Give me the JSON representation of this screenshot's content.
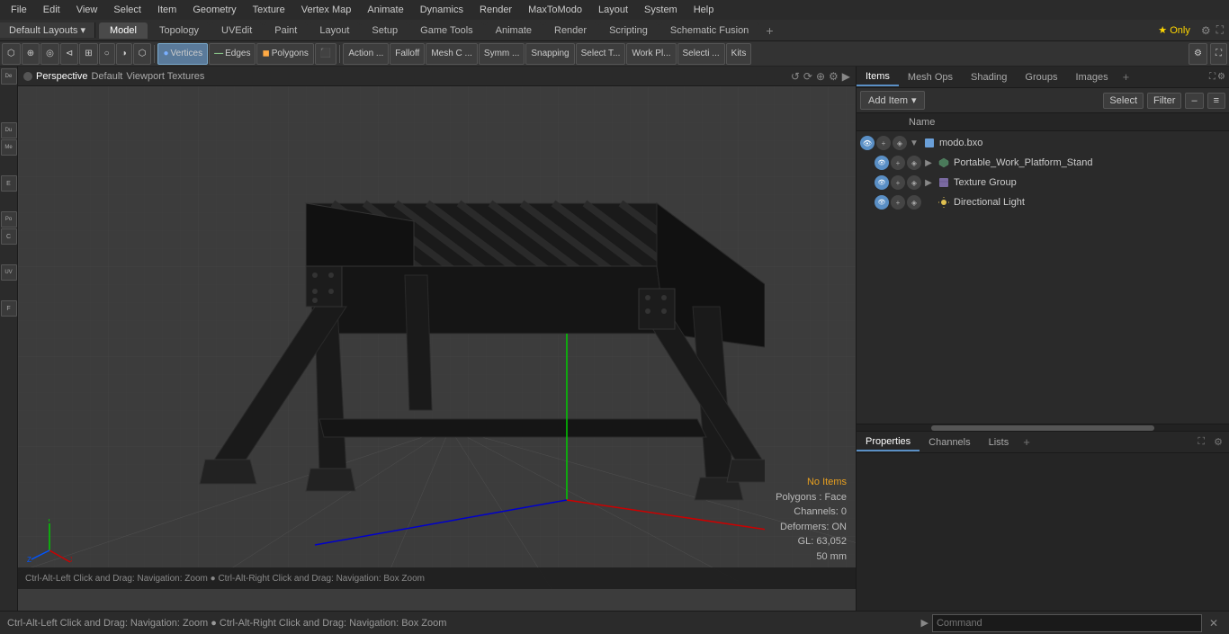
{
  "menu": {
    "items": [
      "File",
      "Edit",
      "View",
      "Select",
      "Item",
      "Geometry",
      "Texture",
      "Vertex Map",
      "Animate",
      "Dynamics",
      "Render",
      "MaxToModo",
      "Layout",
      "System",
      "Help"
    ]
  },
  "layouts_bar": {
    "default_layouts": "Default Layouts ▾",
    "tabs": [
      "Model",
      "Topology",
      "UVEdit",
      "Paint",
      "Layout",
      "Setup",
      "Game Tools",
      "Animate",
      "Render",
      "Scripting",
      "Schematic Fusion"
    ],
    "active_tab": "Model",
    "add_icon": "+",
    "star_only": "★ Only"
  },
  "toolbar": {
    "mode_buttons": [
      "▣",
      "⊕",
      "◎",
      "⊲",
      "⊞",
      "○",
      "◑",
      "⬡"
    ],
    "mesh_modes": [
      "Vertices",
      "Edges",
      "Polygons",
      "▣"
    ],
    "tools": [
      "Action ...",
      "Falloff",
      "Mesh C ...",
      "Symm ...",
      "Snapping",
      "Select T...",
      "Work Pl...",
      "Selecti ...",
      "Kits"
    ]
  },
  "viewport": {
    "dot": "●",
    "perspective": "Perspective",
    "default_label": "Default",
    "textures_label": "Viewport Textures",
    "controls": [
      "↺",
      "⟳",
      "⊕",
      "⚙",
      "▶"
    ]
  },
  "scene_info": {
    "no_items": "No Items",
    "polygons": "Polygons : Face",
    "channels": "Channels: 0",
    "deformers": "Deformers: ON",
    "gl": "GL: 63,052",
    "size": "50 mm"
  },
  "items_panel": {
    "tabs": [
      "Items",
      "Mesh Ops",
      "Shading",
      "Groups",
      "Images"
    ],
    "active_tab": "Items",
    "add_item_btn": "Add Item",
    "add_item_arrow": "▾",
    "select_btn": "Select",
    "filter_btn": "Filter",
    "minus_btn": "–",
    "settings_btn": "≡",
    "name_col": "Name",
    "tree": [
      {
        "id": "modo-bxo",
        "label": "modo.bxo",
        "icon": "cube",
        "level": 0,
        "expand": true,
        "eye": true
      },
      {
        "id": "portable-stand",
        "label": "Portable_Work_Platform_Stand",
        "icon": "mesh",
        "level": 1,
        "expand": false,
        "eye": true
      },
      {
        "id": "texture-group",
        "label": "Texture Group",
        "icon": "texture",
        "level": 1,
        "expand": false,
        "eye": true
      },
      {
        "id": "directional-light",
        "label": "Directional Light",
        "icon": "light",
        "level": 1,
        "expand": false,
        "eye": true
      }
    ]
  },
  "properties_panel": {
    "tabs": [
      "Properties",
      "Channels",
      "Lists"
    ],
    "active_tab": "Properties",
    "add_icon": "+"
  },
  "bottom_bar": {
    "status_text": "Ctrl-Alt-Left Click and Drag: Navigation: Zoom ● Ctrl-Alt-Right Click and Drag: Navigation: Box Zoom",
    "arrow": "▶",
    "command_placeholder": "Command"
  },
  "left_sidebar": {
    "tools": [
      "De",
      "Du",
      "Me",
      "E",
      "Po",
      "C",
      "UV",
      "F"
    ]
  }
}
